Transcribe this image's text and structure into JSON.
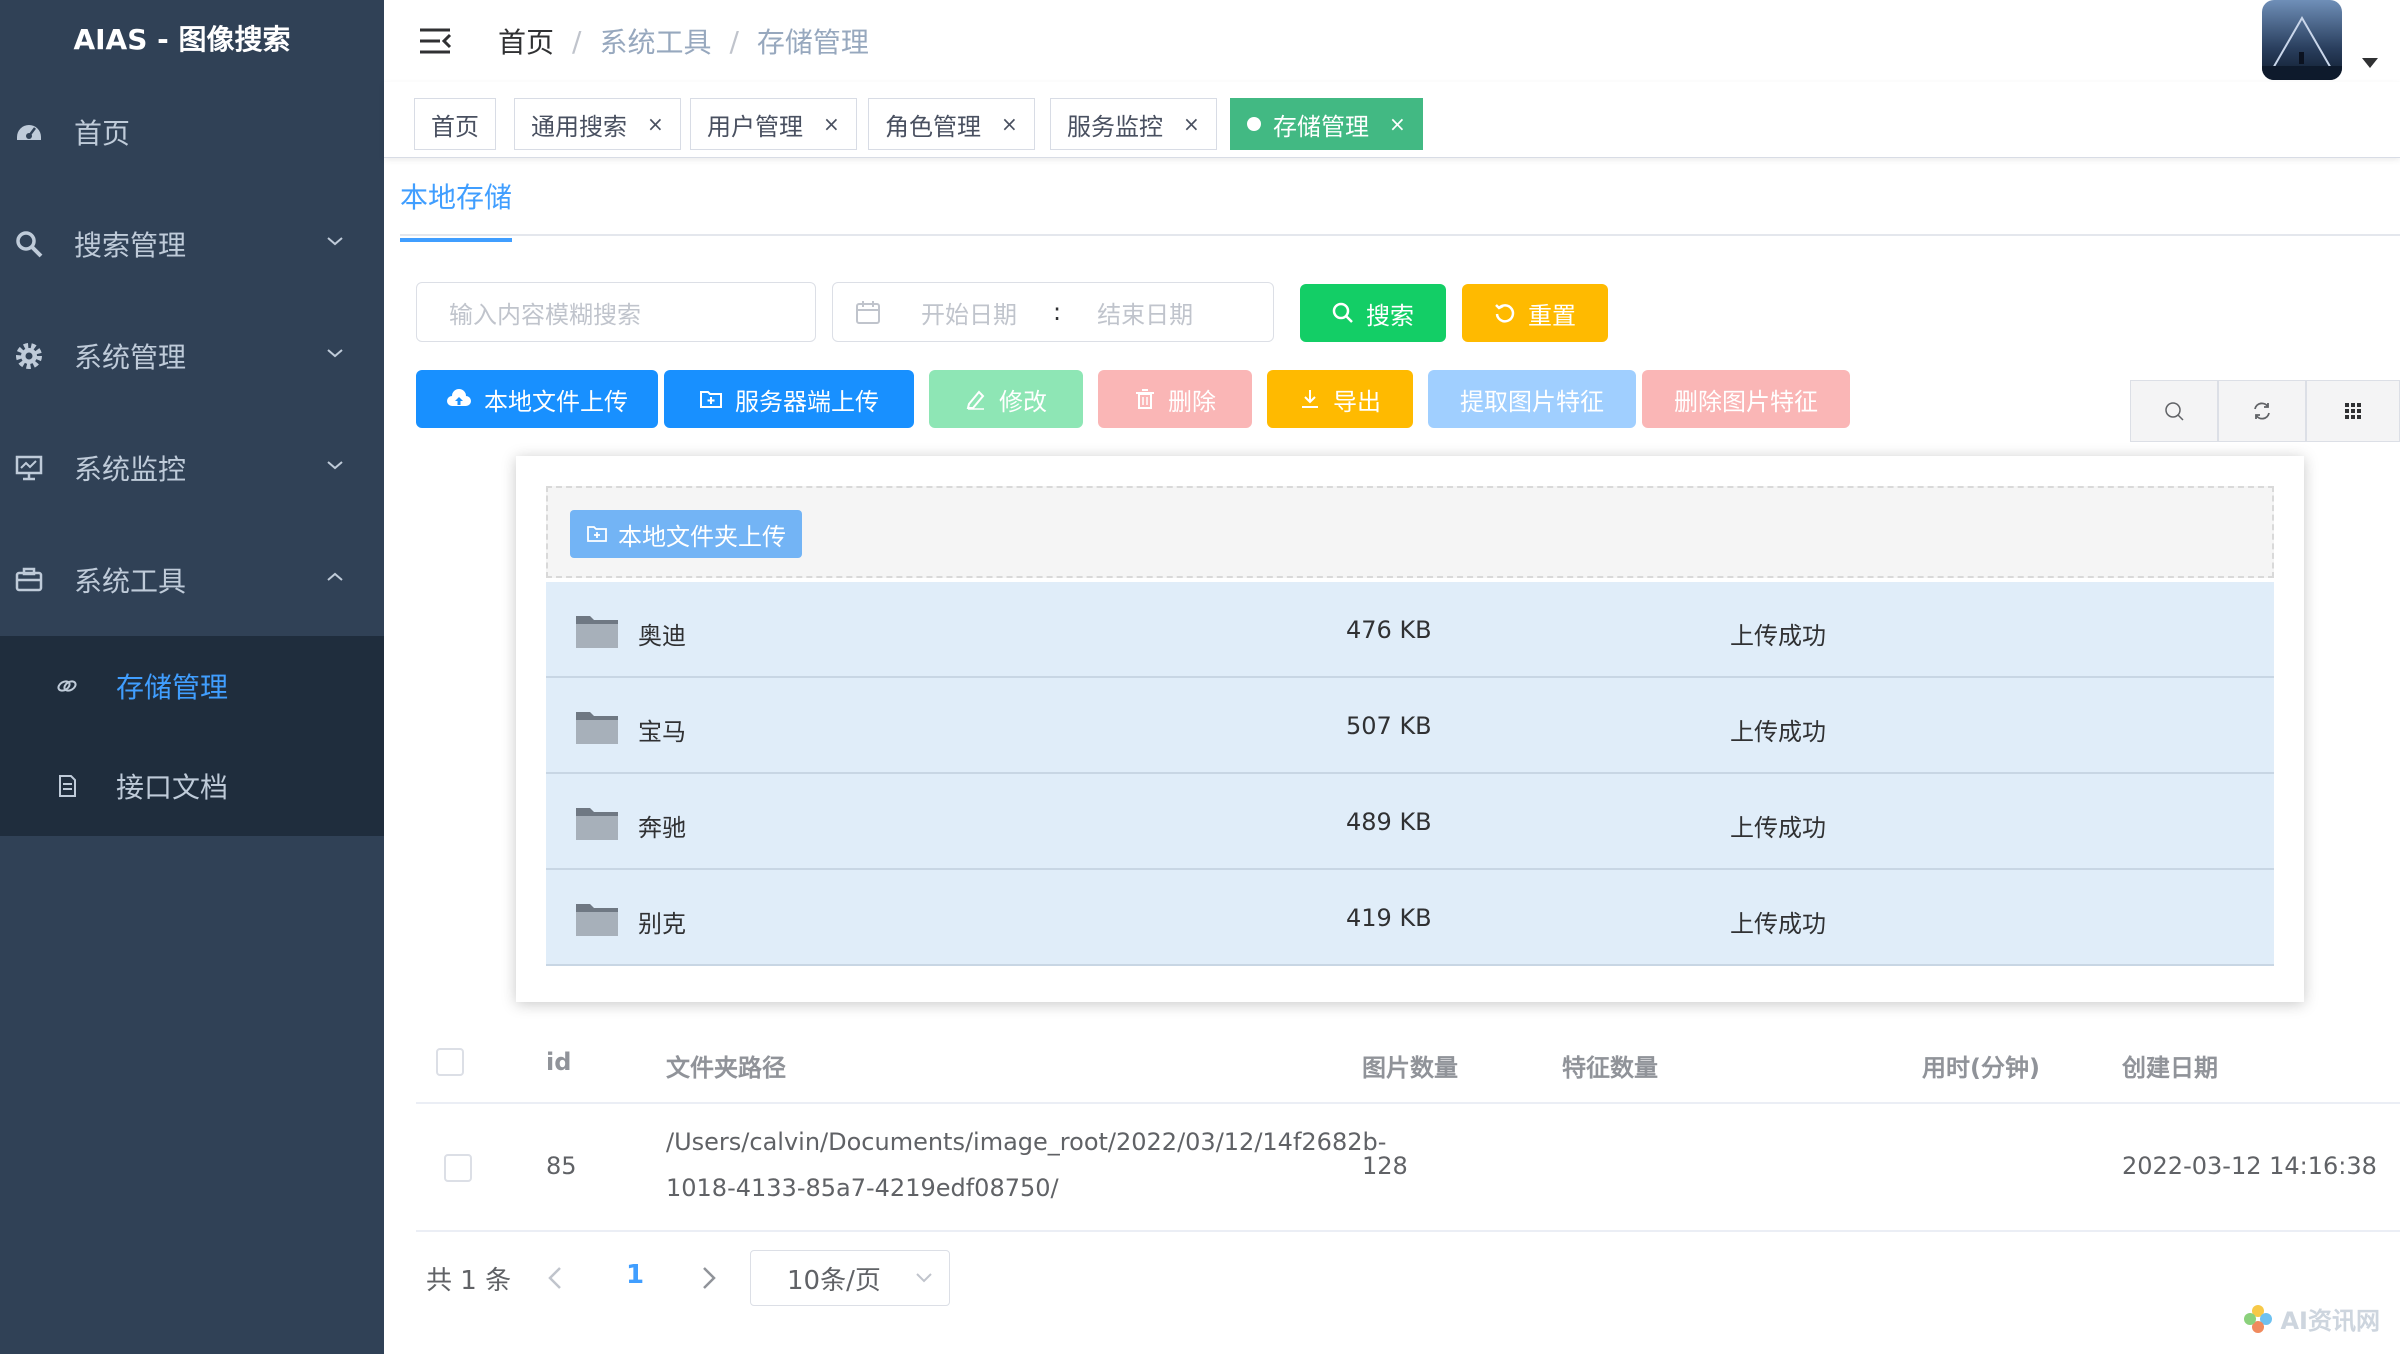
{
  "app": {
    "title": "AIAS - 图像搜索"
  },
  "sidebar": {
    "items": [
      {
        "label": "首页",
        "icon": "dashboard-icon"
      },
      {
        "label": "搜索管理",
        "icon": "search-icon"
      },
      {
        "label": "系统管理",
        "icon": "gear-icon"
      },
      {
        "label": "系统监控",
        "icon": "monitor-icon"
      },
      {
        "label": "系统工具",
        "icon": "toolbox-icon"
      }
    ],
    "submenu": [
      {
        "label": "存储管理",
        "icon": "storage-icon",
        "active": true
      },
      {
        "label": "接口文档",
        "icon": "document-icon"
      }
    ]
  },
  "breadcrumb": [
    "首页",
    "系统工具",
    "存储管理"
  ],
  "tags": [
    "首页",
    "通用搜索",
    "用户管理",
    "角色管理",
    "服务监控",
    "存储管理"
  ],
  "subtab": "本地存储",
  "filters": {
    "search_placeholder": "输入内容模糊搜索",
    "start_date": "开始日期",
    "date_sep": ":",
    "end_date": "结束日期",
    "search_btn": "搜索",
    "reset_btn": "重置"
  },
  "actions": {
    "local_upload": "本地文件上传",
    "server_upload": "服务器端上传",
    "edit": "修改",
    "delete": "删除",
    "export": "导出",
    "extract": "提取图片特征",
    "remove_features": "删除图片特征"
  },
  "upload_dialog": {
    "folder_upload_btn": "本地文件夹上传",
    "files": [
      {
        "name": "奥迪",
        "size": "476 KB",
        "status": "上传成功"
      },
      {
        "name": "宝马",
        "size": "507 KB",
        "status": "上传成功"
      },
      {
        "name": "奔驰",
        "size": "489 KB",
        "status": "上传成功"
      },
      {
        "name": "别克",
        "size": "419 KB",
        "status": "上传成功"
      }
    ]
  },
  "table": {
    "columns": [
      "id",
      "文件夹路径",
      "图片数量",
      "特征数量",
      "用时(分钟)",
      "创建日期"
    ],
    "rows": [
      {
        "id": "85",
        "path_line1": "/Users/calvin/Documents/image_root/2022/03/12/14f2682b-",
        "path_line2": "1018-4133-85a7-4219edf08750/",
        "image_count": "128",
        "feature_count": "",
        "duration": "",
        "created": "2022-03-12 14:16:38"
      }
    ]
  },
  "pagination": {
    "total": "共 1 条",
    "current": "1",
    "page_size": "10条/页"
  },
  "watermark": "AI资讯网",
  "colors": {
    "sidebar_bg": "#304156",
    "submenu_bg": "#1f2d3d",
    "primary": "#409eff",
    "success": "#13ce66",
    "warning": "#ffba00",
    "danger_light": "#fab6b6",
    "tag_active": "#42b983"
  }
}
